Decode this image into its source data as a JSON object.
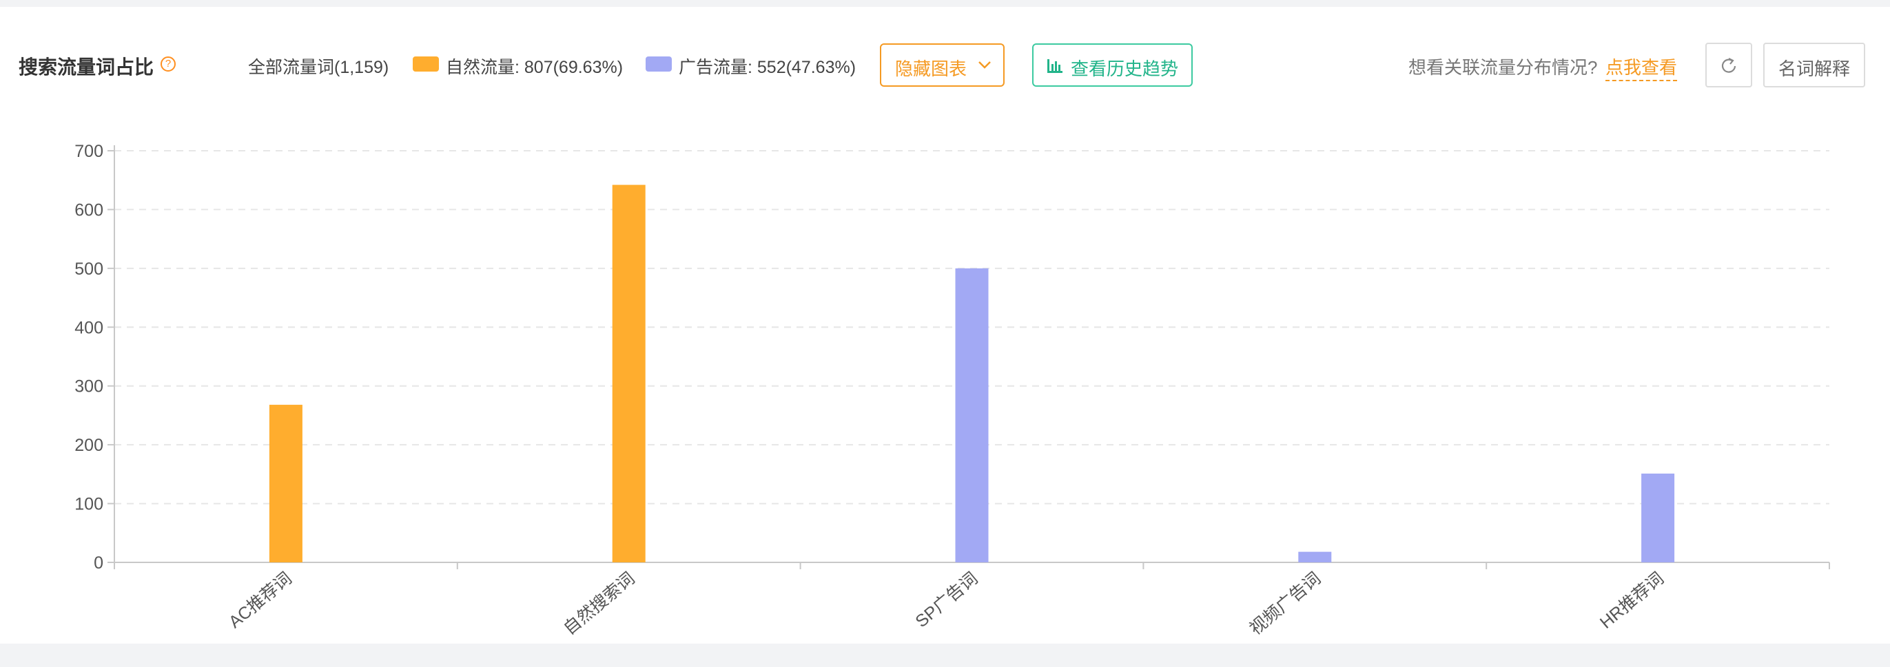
{
  "header": {
    "title": "搜索流量词占比",
    "help_icon": "question-circle-icon",
    "legend": [
      {
        "label": "全部流量词(1,159)"
      },
      {
        "label": "自然流量: 807(69.63%)",
        "color": "#ffad2e"
      },
      {
        "label": "广告流量: 552(47.63%)",
        "color": "#a2a9f4"
      }
    ],
    "hide_chart_label": "隐藏图表",
    "hide_chart_icon": "chevron-down-icon",
    "history_label": "查看历史趋势",
    "history_icon": "bar-chart-icon",
    "prompt_text": "想看关联流量分布情况?",
    "prompt_link": "点我查看",
    "refresh_icon": "refresh-icon",
    "glossary_label": "名词解释"
  },
  "chart_data": {
    "type": "bar",
    "categories": [
      "AC推荐词",
      "自然搜索词",
      "SP广告词",
      "视频广告词",
      "HR推荐词"
    ],
    "values": [
      268,
      642,
      500,
      18,
      151
    ],
    "colors": [
      "#ffad2e",
      "#ffad2e",
      "#a2a9f4",
      "#a2a9f4",
      "#a2a9f4"
    ],
    "ylim": [
      0,
      700
    ],
    "yticks": [
      0,
      100,
      200,
      300,
      400,
      500,
      600,
      700
    ],
    "grid": true
  }
}
